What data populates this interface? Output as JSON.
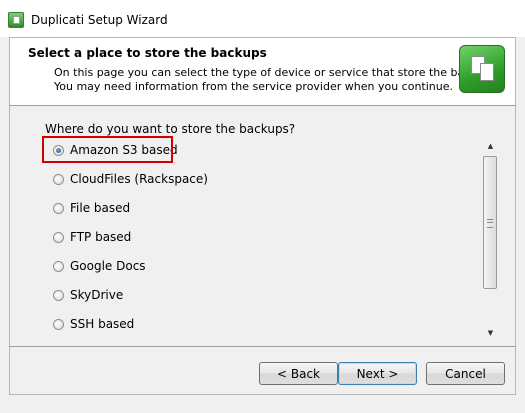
{
  "window": {
    "title": "Duplicati Setup Wizard"
  },
  "header": {
    "title": "Select a place to store the backups",
    "description_line1": "On this page you can select the type of device or service that store the backups.",
    "description_line2": "You may need information from the service provider when you continue.",
    "icon": "duplicati-documents-icon"
  },
  "content": {
    "question": "Where do you want to store the backups?",
    "selected": "Amazon S3 based",
    "options": [
      {
        "label": "Amazon S3 based",
        "checked": true
      },
      {
        "label": "CloudFiles (Rackspace)",
        "checked": false
      },
      {
        "label": "File based",
        "checked": false
      },
      {
        "label": "FTP based",
        "checked": false
      },
      {
        "label": "Google Docs",
        "checked": false
      },
      {
        "label": "SkyDrive",
        "checked": false
      },
      {
        "label": "SSH based",
        "checked": false
      }
    ]
  },
  "buttons": {
    "back": "< Back",
    "next": "Next >",
    "cancel": "Cancel"
  },
  "colors": {
    "highlight": "#d40000",
    "window_bg": "#f0f0f0",
    "header_bg": "#ffffff"
  }
}
